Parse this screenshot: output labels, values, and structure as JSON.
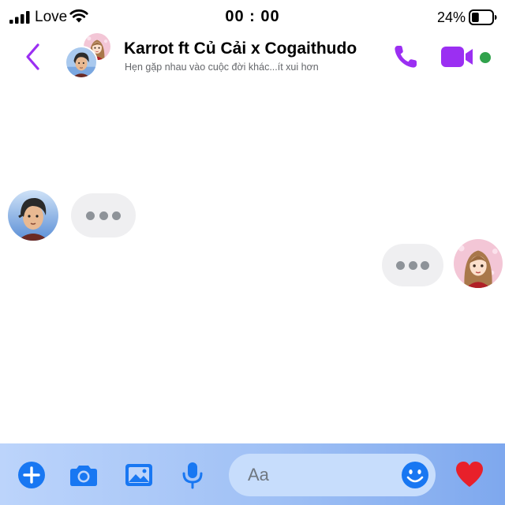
{
  "status_bar": {
    "carrier": "Love",
    "time": "00 : 00",
    "battery_percent": "24%",
    "battery_level": 0.24,
    "icons": [
      "signal-icon",
      "wifi-icon",
      "battery-icon"
    ]
  },
  "header": {
    "title": "Karrot ft Củ Cải x Cogaithudo",
    "subtitle": "Hẹn gặp nhau vào cuộc đời khác...ít xui hơn",
    "icons": [
      "back-chevron-icon",
      "phone-icon",
      "video-camera-icon"
    ],
    "online": true
  },
  "messages": [
    {
      "sender": "boy",
      "state": "typing"
    },
    {
      "sender": "girl",
      "state": "typing"
    }
  ],
  "composer": {
    "placeholder": "Aa",
    "value": "",
    "icons": [
      "plus-icon",
      "camera-icon",
      "image-icon",
      "microphone-icon",
      "emoji-icon",
      "heart-icon"
    ]
  },
  "colors": {
    "accent_purple": "#9b2ff2",
    "messenger_blue": "#1877f2",
    "online_green": "#31a24c",
    "heart_red": "#e8202a",
    "bubble_grey": "#efeff1"
  }
}
